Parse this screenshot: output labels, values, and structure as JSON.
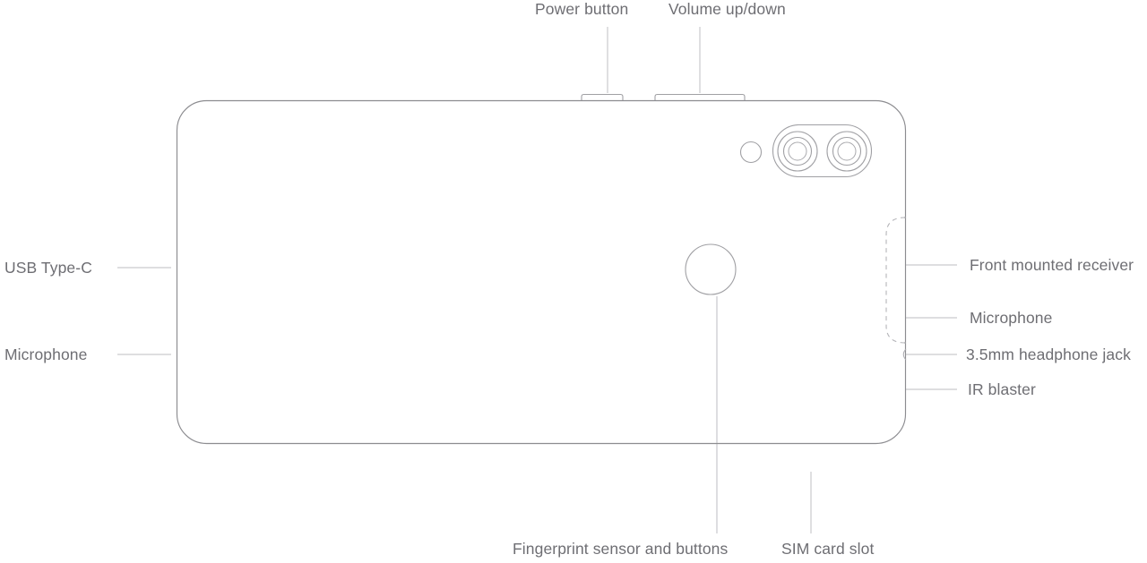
{
  "diagram": {
    "title": "Smartphone hardware callout diagram",
    "device": "smartphone-rear-view",
    "stroke_color": "#8c8c90",
    "label_color": "#6e6e73",
    "leader_color": "#c9c9cd",
    "background_color": "#ffffff"
  },
  "callouts": {
    "top": [
      {
        "id": "power-button",
        "label": "Power button"
      },
      {
        "id": "volume-rocker",
        "label": "Volume up/down"
      }
    ],
    "left": [
      {
        "id": "usb-type-c",
        "label": "USB Type-C"
      },
      {
        "id": "microphone-bottom",
        "label": "Microphone"
      }
    ],
    "right": [
      {
        "id": "front-mounted-receiver",
        "label": "Front mounted receiver"
      },
      {
        "id": "microphone-top",
        "label": "Microphone"
      },
      {
        "id": "headphone-jack",
        "label": "3.5mm headphone jack"
      },
      {
        "id": "ir-blaster",
        "label": "IR blaster"
      }
    ],
    "bottom": [
      {
        "id": "fingerprint-sensor",
        "label": "Fingerprint sensor and buttons"
      },
      {
        "id": "sim-card-slot",
        "label": "SIM card slot"
      }
    ]
  },
  "device_parts": {
    "camera_module": "dual-camera-module",
    "flash": "camera-flash",
    "fingerprint": "fingerprint-sensor-circle",
    "sim_tray": "sim-tray-outline"
  }
}
